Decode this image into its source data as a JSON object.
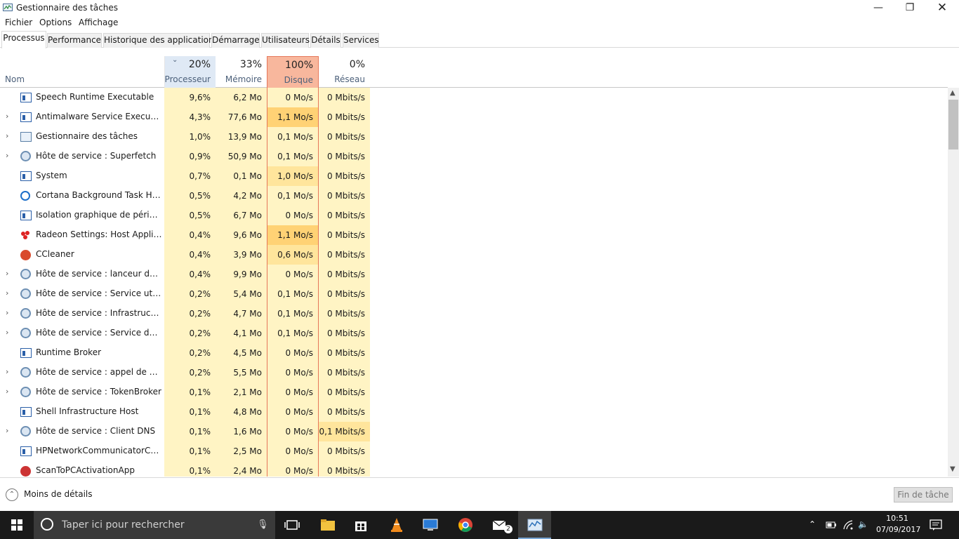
{
  "window": {
    "title": "Gestionnaire des tâches",
    "minimize": "—",
    "maximize": "❐",
    "close": "✕"
  },
  "menu": [
    "Fichier",
    "Options",
    "Affichage"
  ],
  "tabs": [
    "Processus",
    "Performance",
    "Historique des applications",
    "Démarrage",
    "Utilisateurs",
    "Détails",
    "Services"
  ],
  "columns": {
    "name": "Nom",
    "cpu": {
      "pct": "20%",
      "label": "Processeur"
    },
    "mem": {
      "pct": "33%",
      "label": "Mémoire"
    },
    "disk": {
      "pct": "100%",
      "label": "Disque"
    },
    "net": {
      "pct": "0%",
      "label": "Réseau"
    }
  },
  "processes": [
    {
      "name": "Speech Runtime Executable",
      "icon": "window",
      "expand": false,
      "cpu": "9,6%",
      "mem": "6,2 Mo",
      "disk": "0 Mo/s",
      "net": "0 Mbits/s"
    },
    {
      "name": "Antimalware Service Executable",
      "icon": "window",
      "expand": true,
      "cpu": "4,3%",
      "mem": "77,6 Mo",
      "disk": "1,1 Mo/s",
      "net": "0 Mbits/s"
    },
    {
      "name": "Gestionnaire des tâches",
      "icon": "task-manager",
      "expand": true,
      "cpu": "1,0%",
      "mem": "13,9 Mo",
      "disk": "0,1 Mo/s",
      "net": "0 Mbits/s"
    },
    {
      "name": "Hôte de service : Superfetch",
      "icon": "gear",
      "expand": true,
      "cpu": "0,9%",
      "mem": "50,9 Mo",
      "disk": "0,1 Mo/s",
      "net": "0 Mbits/s"
    },
    {
      "name": "System",
      "icon": "window",
      "expand": false,
      "cpu": "0,7%",
      "mem": "0,1 Mo",
      "disk": "1,0 Mo/s",
      "net": "0 Mbits/s"
    },
    {
      "name": "Cortana Background Task Host",
      "icon": "cortana",
      "expand": false,
      "cpu": "0,5%",
      "mem": "4,2 Mo",
      "disk": "0,1 Mo/s",
      "net": "0 Mbits/s"
    },
    {
      "name": "Isolation graphique de périphéri...",
      "icon": "window",
      "expand": false,
      "cpu": "0,5%",
      "mem": "6,7 Mo",
      "disk": "0 Mo/s",
      "net": "0 Mbits/s"
    },
    {
      "name": "Radeon Settings: Host Applicati...",
      "icon": "radeon",
      "expand": false,
      "cpu": "0,4%",
      "mem": "9,6 Mo",
      "disk": "1,1 Mo/s",
      "net": "0 Mbits/s"
    },
    {
      "name": "CCleaner",
      "icon": "ccleaner",
      "expand": false,
      "cpu": "0,4%",
      "mem": "3,9 Mo",
      "disk": "0,6 Mo/s",
      "net": "0 Mbits/s"
    },
    {
      "name": "Hôte de service : lanceur de pro...",
      "icon": "gear",
      "expand": true,
      "cpu": "0,4%",
      "mem": "9,9 Mo",
      "disk": "0 Mo/s",
      "net": "0 Mbits/s"
    },
    {
      "name": "Hôte de service : Service utilisat...",
      "icon": "gear",
      "expand": true,
      "cpu": "0,2%",
      "mem": "5,4 Mo",
      "disk": "0,1 Mo/s",
      "net": "0 Mbits/s"
    },
    {
      "name": "Hôte de service : Infrastructure ...",
      "icon": "gear",
      "expand": true,
      "cpu": "0,2%",
      "mem": "4,7 Mo",
      "disk": "0,1 Mo/s",
      "net": "0 Mbits/s"
    },
    {
      "name": "Hôte de service : Service de tran...",
      "icon": "gear",
      "expand": true,
      "cpu": "0,2%",
      "mem": "4,1 Mo",
      "disk": "0,1 Mo/s",
      "net": "0 Mbits/s"
    },
    {
      "name": "Runtime Broker",
      "icon": "window",
      "expand": false,
      "cpu": "0,2%",
      "mem": "4,5 Mo",
      "disk": "0 Mo/s",
      "net": "0 Mbits/s"
    },
    {
      "name": "Hôte de service : appel de procé...",
      "icon": "gear",
      "expand": true,
      "cpu": "0,2%",
      "mem": "5,5 Mo",
      "disk": "0 Mo/s",
      "net": "0 Mbits/s"
    },
    {
      "name": "Hôte de service : TokenBroker",
      "icon": "gear",
      "expand": true,
      "cpu": "0,1%",
      "mem": "2,1 Mo",
      "disk": "0 Mo/s",
      "net": "0 Mbits/s"
    },
    {
      "name": "Shell Infrastructure Host",
      "icon": "window",
      "expand": false,
      "cpu": "0,1%",
      "mem": "4,8 Mo",
      "disk": "0 Mo/s",
      "net": "0 Mbits/s"
    },
    {
      "name": "Hôte de service : Client DNS",
      "icon": "gear",
      "expand": true,
      "cpu": "0,1%",
      "mem": "1,6 Mo",
      "disk": "0 Mo/s",
      "net": "0,1 Mbits/s"
    },
    {
      "name": "HPNetworkCommunicatorCom",
      "icon": "window",
      "expand": false,
      "cpu": "0,1%",
      "mem": "2,5 Mo",
      "disk": "0 Mo/s",
      "net": "0 Mbits/s"
    },
    {
      "name": "ScanToPCActivationApp",
      "icon": "scan",
      "expand": false,
      "cpu": "0,1%",
      "mem": "2,4 Mo",
      "disk": "0 Mo/s",
      "net": "0 Mbits/s"
    }
  ],
  "footer": {
    "less_details": "Moins de détails",
    "end_task": "Fin de tâche"
  },
  "taskbar": {
    "search_placeholder": "Taper ici pour rechercher",
    "time": "10:51",
    "date": "07/09/2017",
    "mail_badge": "2"
  }
}
